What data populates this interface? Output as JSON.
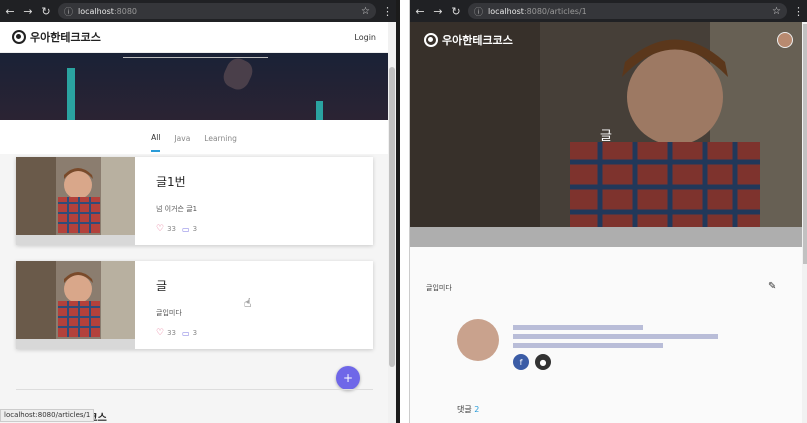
{
  "left": {
    "browser": {
      "url_host": "localhost",
      "url_rest": ":8080"
    },
    "nav": {
      "brand": "우아한테크코스",
      "login": "Login"
    },
    "tabs": [
      {
        "label": "All",
        "active": true
      },
      {
        "label": "Java",
        "active": false
      },
      {
        "label": "Learning",
        "active": false
      }
    ],
    "articles": [
      {
        "title": "글1번",
        "description": "넘 이거슨 글1",
        "likes": "33",
        "comments": "3"
      },
      {
        "title": "글",
        "description": "글입미다",
        "likes": "33",
        "comments": "3"
      }
    ],
    "fab_label": "+",
    "status_url": "localhost:8080/articles/1",
    "footer_brand": "테크코스"
  },
  "right": {
    "browser": {
      "url_host": "localhost",
      "url_rest": ":8080/articles/1"
    },
    "brand": "우아한테크코스",
    "article_title": "글",
    "content": "글입미다",
    "comments_label": "댓글",
    "comments_count": "2"
  },
  "colors": {
    "accent": "#2b9cd8",
    "fab": "#6f67e8",
    "heart": "#e0507a",
    "bubble": "#7a74e0"
  }
}
